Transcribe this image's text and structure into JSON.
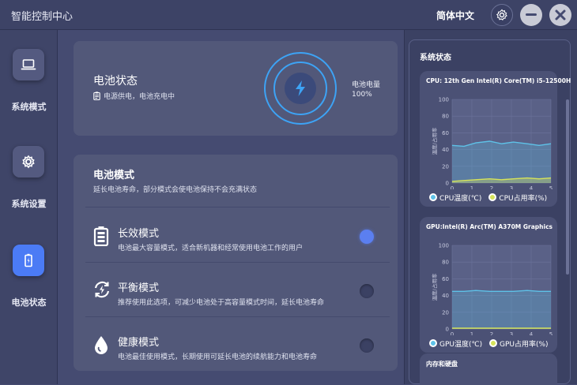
{
  "app": {
    "title": "智能控制中心"
  },
  "titlebar": {
    "language": "简体中文"
  },
  "sidebar": {
    "items": [
      {
        "label": "系统模式",
        "icon": "laptop-icon"
      },
      {
        "label": "系统设置",
        "icon": "gear-icon"
      },
      {
        "label": "电池状态",
        "icon": "battery-icon",
        "active": true
      }
    ]
  },
  "battery_status": {
    "title": "电池状态",
    "subtitle": "电源供电，电池充电中",
    "level_label": "电池电量",
    "level_value": "100%"
  },
  "battery_mode": {
    "title": "电池模式",
    "subtitle": "延长电池寿命，部分模式会使电池保持不会充满状态",
    "modes": [
      {
        "name": "长效模式",
        "desc": "电池最大容量模式，适合新机器和经常使用电池工作的用户",
        "icon": "battery-full-icon",
        "selected": true
      },
      {
        "name": "平衡模式",
        "desc": "推荐使用此选项，可减少电池处于高容量模式时间，延长电池寿命",
        "icon": "balance-icon",
        "selected": false
      },
      {
        "name": "健康模式",
        "desc": "电池最佳使用模式，长期使用可延长电池的续航能力和电池寿命",
        "icon": "drop-icon",
        "selected": false
      }
    ]
  },
  "system_status": {
    "title": "系统状态",
    "memory_title": "内存和硬盘"
  },
  "colors": {
    "accent": "#4b7bf5",
    "temp_line": "#5ec2e8",
    "usage_line": "#d6e35a"
  },
  "chart_data": [
    {
      "type": "area",
      "title": "CPU:  12th Gen Intel(R) Core(TM) i5-12500H",
      "ylabel": "温度/占用率",
      "x": [
        0,
        1,
        2,
        3,
        4,
        5
      ],
      "x_ticks": [
        "0",
        "1",
        "2",
        "3",
        "4",
        "5"
      ],
      "y_ticks": [
        "0",
        "20",
        "40",
        "60",
        "80",
        "100"
      ],
      "ylim": [
        0,
        100
      ],
      "grid": true,
      "series": [
        {
          "name": "CPU温度(℃)",
          "color": "#5ec2e8",
          "values": [
            45,
            44,
            48,
            50,
            47,
            49,
            47,
            45,
            47
          ]
        },
        {
          "name": "CPU占用率(%)",
          "color": "#d6e35a",
          "values": [
            2,
            3,
            4,
            5,
            4,
            5,
            6,
            5,
            6
          ]
        }
      ],
      "x_samples": [
        0,
        0.6,
        1.2,
        1.9,
        2.5,
        3.1,
        3.8,
        4.4,
        5
      ]
    },
    {
      "type": "area",
      "title": "GPU:Intel(R) Arc(TM) A370M Graphics",
      "ylabel": "温度/占用率",
      "x": [
        0,
        1,
        2,
        3,
        4,
        5
      ],
      "x_ticks": [
        "0",
        "1",
        "2",
        "3",
        "4",
        "5"
      ],
      "y_ticks": [
        "0",
        "20",
        "40",
        "60",
        "80",
        "100"
      ],
      "ylim": [
        0,
        100
      ],
      "grid": true,
      "series": [
        {
          "name": "GPU温度(℃)",
          "color": "#5ec2e8",
          "values": [
            45,
            45,
            46,
            45,
            45,
            45,
            46,
            45,
            45
          ]
        },
        {
          "name": "GPU占用率(%)",
          "color": "#d6e35a",
          "values": [
            1,
            1,
            1,
            1,
            1,
            1,
            1,
            1,
            1
          ]
        }
      ],
      "x_samples": [
        0,
        0.6,
        1.2,
        1.9,
        2.5,
        3.1,
        3.8,
        4.4,
        5
      ]
    }
  ]
}
